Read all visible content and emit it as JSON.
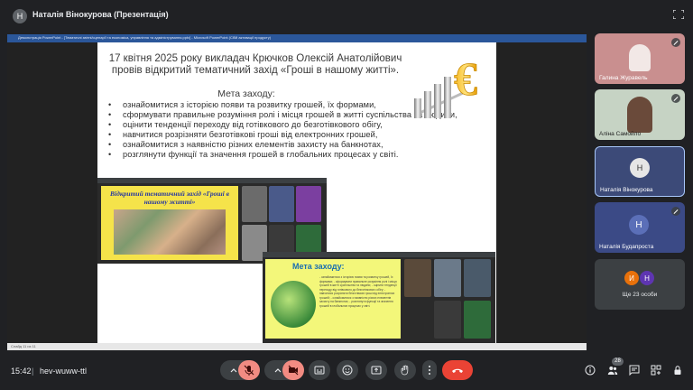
{
  "topbar": {
    "presenter_title": "Наталія Вінокурова (Презентація)",
    "presenter_initial": "Н"
  },
  "powerpoint": {
    "window_title": "Демонстрація PowerPoint - [Тематичні звітні/сценарії та економіка, управління та адміністрування.pptx] - Microsoft PowerPoint (Сбій активації продукту)",
    "status_text": "Слайд 11 из 11"
  },
  "slide": {
    "heading": "17 квітня 2025 року викладач Крючков Олексій Анатолійович провів відкритий тематичний захід «Гроші в нашому житті».",
    "subheading": "Мета заходу:",
    "goals": [
      "ознайомитися з історією появи та розвитку грошей, їх формами,",
      "сформувати правильне розуміння ролі і місця грошей в житті суспільства та людини,",
      "оцінити тенденції переходу від готівкового до безготівкового обігу,",
      "навчитися розрізняти безготівкові гроші від електронних грошей,",
      "ознайомитися з наявністю різних елементів захисту на банкнотах,",
      "розглянути функції та значення грошей в глобальних процесах у світі."
    ],
    "photo1_title": "Відкритий тематичний захід «Гроші в нашому житті»",
    "photo2_title": "Мета заходу:",
    "photo2_text": "- ознайомитися з історією появи та розвитку грошей, їх формами; - сформувати правильне розуміння ролі і місця грошей в житті суспільства та людини; - оцінити тенденції переходу від готівкового до безготівкового обігу; - навчитися розрізняти безготівкові гроші від електронних грошей; - ознайомитися з наявністю різних елементів захисту на банкнотах; - розглянути функції та значення грошей в глобальних процесах у світі."
  },
  "participants": [
    {
      "name": "Галина Журавель",
      "bg": "#d9a0a0"
    },
    {
      "name": "Аліна Самойло",
      "bg": "#cfd9c9"
    },
    {
      "name": "Наталія Вінокурова",
      "bg": "#a8c7fa",
      "initial": "Н"
    },
    {
      "name": "Наталія Будапроста",
      "initial": "Н",
      "bg": "#3a4a8a"
    }
  ],
  "others": {
    "label": "Ще 23 особи",
    "avatars": [
      "И",
      "Н"
    ]
  },
  "bottombar": {
    "time": "15:42",
    "separator": "|",
    "meeting_code": "hev-wuww-ttl",
    "participants_count": "28"
  },
  "colors": {
    "background": "#202124",
    "end_call": "#ea4335",
    "muted": "#f28b82",
    "accent": "#8ab4f8"
  }
}
